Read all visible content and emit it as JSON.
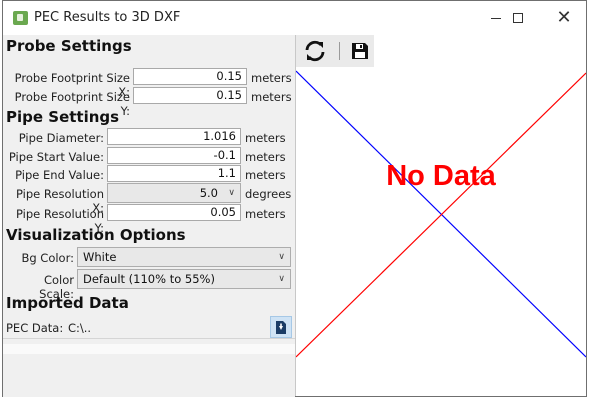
{
  "window": {
    "title": "PEC Results to 3D DXF",
    "icon": "app-icon"
  },
  "probe": {
    "heading": "Probe Settings",
    "footprint_x": {
      "label": "Probe Footprint Size X:",
      "value": "0.15",
      "unit": "meters"
    },
    "footprint_y": {
      "label": "Probe Footprint Size Y:",
      "value": "0.15",
      "unit": "meters"
    }
  },
  "pipe": {
    "heading": "Pipe Settings",
    "diameter": {
      "label": "Pipe Diameter:",
      "value": "1.016",
      "unit": "meters"
    },
    "start": {
      "label": "Pipe Start Value:",
      "value": "-0.1",
      "unit": "meters"
    },
    "end": {
      "label": "Pipe End Value:",
      "value": "1.1",
      "unit": "meters"
    },
    "resolution_x": {
      "label": "Pipe Resolution X:",
      "value": "5.0",
      "unit": "degrees"
    },
    "resolution_y": {
      "label": "Pipe Resolution Y:",
      "value": "0.05",
      "unit": "meters"
    }
  },
  "visualization": {
    "heading": "Visualization Options",
    "bg_color": {
      "label": "Bg Color:",
      "value": "White"
    },
    "color_scale": {
      "label": "Color Scale:",
      "value": "Default (110% to 55%)"
    }
  },
  "imported": {
    "heading": "Imported Data",
    "pec_label": "PEC Data:",
    "pec_value": "C:\\.."
  },
  "viewer": {
    "no_data": "No Data",
    "toolbar": [
      "refresh-icon",
      "save-icon"
    ],
    "colors": {
      "diag_blue": "#0000ff",
      "diag_red": "#ff0000",
      "no_data": "#ff0000"
    }
  }
}
